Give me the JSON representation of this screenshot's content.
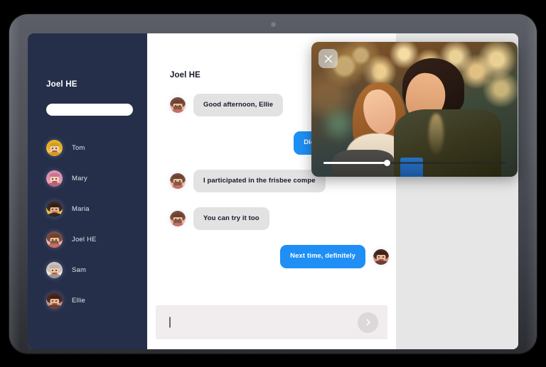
{
  "device": {
    "kind": "tablet-mockup",
    "bezel_color": "#4e5159",
    "background_color": "#000000"
  },
  "sidebar": {
    "title": "Joel HE",
    "background_color": "#262f49",
    "search": {
      "value": "",
      "placeholder": ""
    },
    "add_button_label": "+",
    "add_button_color": "#1f8ff5",
    "contacts": [
      {
        "name": "Tom",
        "avatar": "avatar-tom"
      },
      {
        "name": "Mary",
        "avatar": "avatar-mary"
      },
      {
        "name": "Maria",
        "avatar": "avatar-maria"
      },
      {
        "name": "Joel HE",
        "avatar": "avatar-joel"
      },
      {
        "name": "Sam",
        "avatar": "avatar-sam"
      },
      {
        "name": "Ellie",
        "avatar": "avatar-ellie"
      }
    ]
  },
  "chat": {
    "title": "Joel HE",
    "incoming_bubble_color": "#e2e2e2",
    "outgoing_bubble_color": "#1f8ff5",
    "messages": [
      {
        "direction": "in",
        "text": "Good afternoon, Ellie",
        "avatar": "avatar-joel"
      },
      {
        "direction": "out",
        "text": "Did you have a good",
        "avatar": "avatar-ellie"
      },
      {
        "direction": "in",
        "text": "I participated in the frisbee compe",
        "avatar": "avatar-joel"
      },
      {
        "direction": "in",
        "text": "You can try it too",
        "avatar": "avatar-joel"
      },
      {
        "direction": "out",
        "text": "Next time, definitely",
        "avatar": "avatar-ellie"
      }
    ],
    "composer": {
      "value": "",
      "placeholder": "",
      "send_icon": "chevron-right-icon",
      "background_color": "#f1ecee"
    }
  },
  "right_panel": {
    "background_color": "#e6e6e6"
  },
  "video_overlay": {
    "close_icon": "close-icon",
    "scene_description": "couple laughing together under string lights",
    "progress_percent": 35
  }
}
